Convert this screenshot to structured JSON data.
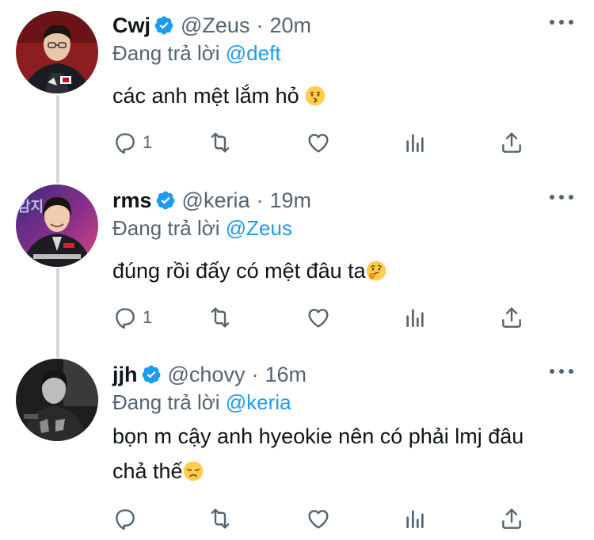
{
  "colors": {
    "accent": "#1d9bf0",
    "secondary_text": "#536471",
    "thread_line": "#cfd9de"
  },
  "tweets": [
    {
      "name": "Cwj",
      "handle": "@Zeus",
      "separator": "·",
      "time": "20m",
      "reply_prefix": "Đang trả lời ",
      "reply_to": "@deft",
      "text": "các anh mệt lắm hỏ ",
      "text_line2": "",
      "emoji": "kissing-face-emoji",
      "reply_count": "1",
      "avatar": "zeus-avatar"
    },
    {
      "name": "rms",
      "handle": "@keria",
      "separator": "·",
      "time": "19m",
      "reply_prefix": "Đang trả lời ",
      "reply_to": "@Zeus",
      "text": "đúng rồi đấy có mệt đâu ta",
      "text_line2": "",
      "emoji": "thinking-face-emoji",
      "reply_count": "1",
      "avatar": "keria-avatar"
    },
    {
      "name": "jjh",
      "handle": "@chovy",
      "separator": "·",
      "time": "16m",
      "reply_prefix": "Đang trả lời ",
      "reply_to": "@keria",
      "text": "bọn m cậy anh hyeokie nên có phải lmj đâu",
      "text_line2": "chả thế",
      "emoji": "disappointed-face-emoji",
      "reply_count": "",
      "avatar": "chovy-avatar"
    }
  ]
}
